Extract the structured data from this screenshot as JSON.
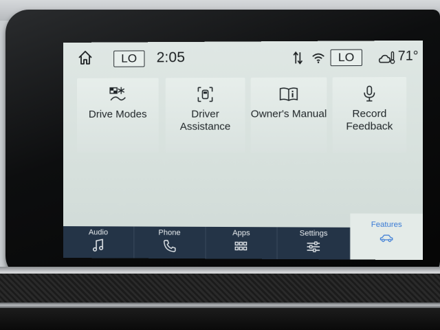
{
  "status_bar": {
    "lo_left": "LO",
    "time": "2:05",
    "lo_right": "LO",
    "temperature": "71°",
    "icons": [
      "home-icon",
      "data-transfer-icon",
      "wifi-icon",
      "weather-icon"
    ]
  },
  "tiles": [
    {
      "label": "Drive Modes",
      "icon": "drive-modes-icon"
    },
    {
      "label": "Driver Assistance",
      "icon": "driver-assist-icon"
    },
    {
      "label": "Owner's Manual",
      "icon": "manual-icon"
    },
    {
      "label": "Record Feedback",
      "icon": "microphone-icon"
    }
  ],
  "nav": [
    {
      "label": "Audio",
      "icon": "music-note-icon"
    },
    {
      "label": "Phone",
      "icon": "phone-icon"
    },
    {
      "label": "Apps",
      "icon": "apps-grid-icon"
    },
    {
      "label": "Settings",
      "icon": "sliders-icon"
    },
    {
      "label": "Features",
      "icon": "car-icon",
      "active": true
    }
  ],
  "colors": {
    "screen_bg": "#dfe7e4",
    "nav_bg": "#243447",
    "active_accent": "#3a7bd5"
  }
}
